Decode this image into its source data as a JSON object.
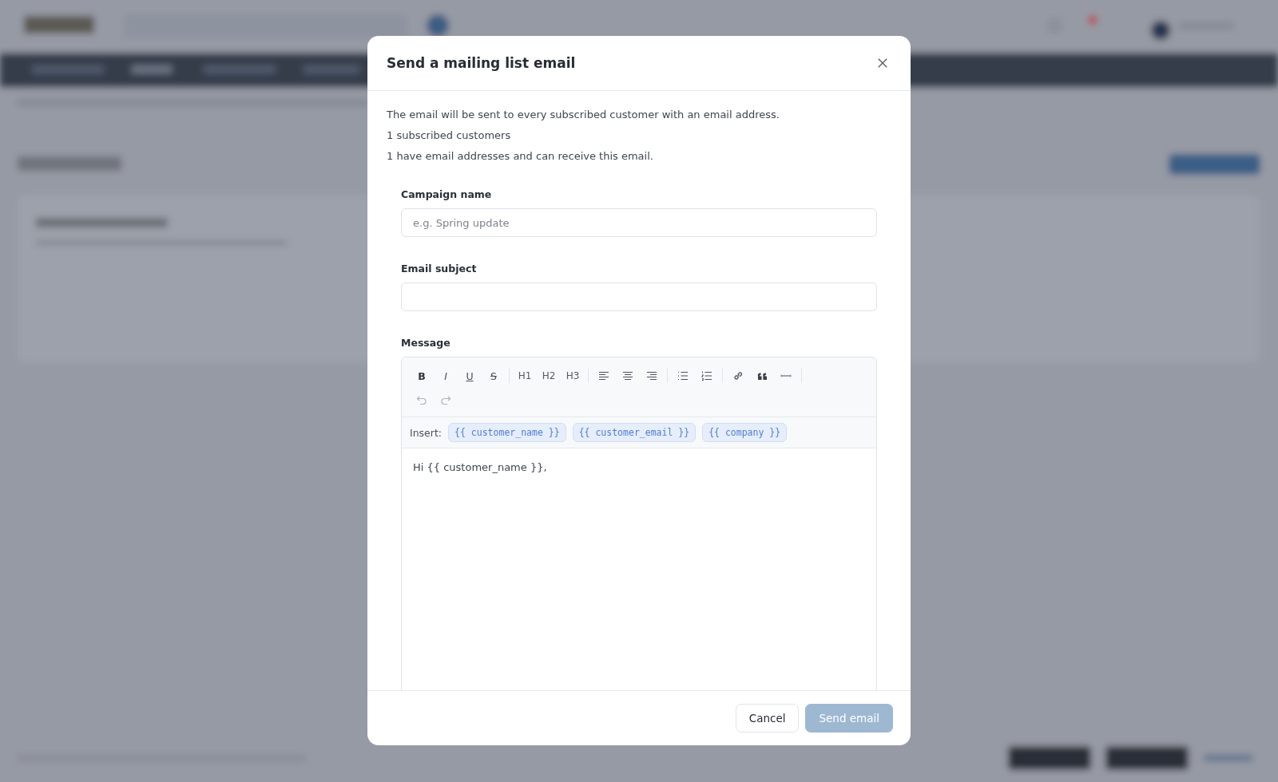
{
  "dialog": {
    "title": "Send a mailing list email",
    "intro": [
      "The email will be sent to every subscribed customer with an email address.",
      "1 subscribed customers",
      "1 have email addresses and can receive this email."
    ],
    "fields": [
      {
        "label": "Campaign name",
        "placeholder": "e.g. Spring update"
      },
      {
        "label": "Email subject"
      }
    ],
    "message": {
      "label": "Message",
      "toolbar": {
        "format": [
          "B",
          "I",
          "U",
          "S"
        ],
        "headings": [
          "H1",
          "H2",
          "H3"
        ],
        "undo_disabled": true,
        "redo_disabled": true
      },
      "insert_label": "Insert:",
      "variables": [
        "{{ customer_name }}",
        "{{ customer_email }}",
        "{{ company }}"
      ],
      "body": "Hi {{ customer_name }},"
    },
    "buttons": [
      {
        "label": "Cancel",
        "kind": "secondary",
        "disabled": false
      },
      {
        "label": "Send email",
        "kind": "primary",
        "disabled": true
      }
    ]
  }
}
